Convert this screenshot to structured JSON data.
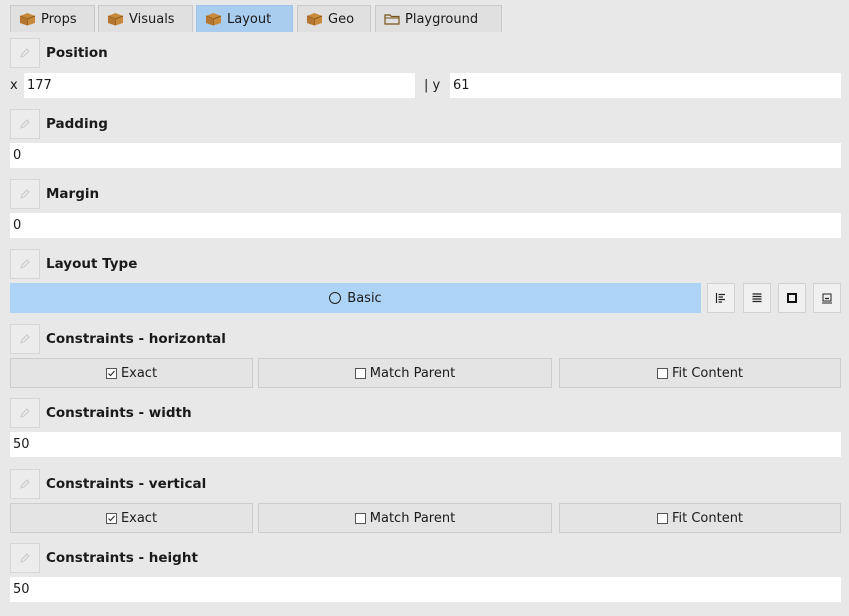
{
  "tabs": [
    {
      "label": "Props",
      "icon": "package-icon"
    },
    {
      "label": "Visuals",
      "icon": "package-icon"
    },
    {
      "label": "Layout",
      "icon": "package-icon",
      "active": true
    },
    {
      "label": "Geo",
      "icon": "package-icon"
    },
    {
      "label": "Playground",
      "icon": "folder-icon"
    }
  ],
  "position": {
    "title": "Position",
    "x_label": "x",
    "x_value": "177",
    "sep_label": "| y",
    "y_value": "61"
  },
  "padding": {
    "title": "Padding",
    "value": "0"
  },
  "margin": {
    "title": "Margin",
    "value": "0"
  },
  "layout_type": {
    "title": "Layout Type",
    "selected": "Basic",
    "buttons": [
      "align-left-icon",
      "justify-icon",
      "frame-icon",
      "minimize-icon"
    ]
  },
  "constraints_horizontal": {
    "title": "Constraints - horizontal",
    "options": [
      {
        "label": "Exact",
        "checked": true
      },
      {
        "label": "Match Parent",
        "checked": false
      },
      {
        "label": "Fit Content",
        "checked": false
      }
    ]
  },
  "constraints_width": {
    "title": "Constraints - width",
    "value": "50"
  },
  "constraints_vertical": {
    "title": "Constraints - vertical",
    "options": [
      {
        "label": "Exact",
        "checked": true
      },
      {
        "label": "Match Parent",
        "checked": false
      },
      {
        "label": "Fit Content",
        "checked": false
      }
    ]
  },
  "constraints_height": {
    "title": "Constraints - height",
    "value": "50"
  },
  "colors": {
    "active_tab": "#a8cdef",
    "layout_selected": "#add3f7",
    "field_bg": "#ffffff",
    "panel_bg": "#e8e8e8"
  }
}
